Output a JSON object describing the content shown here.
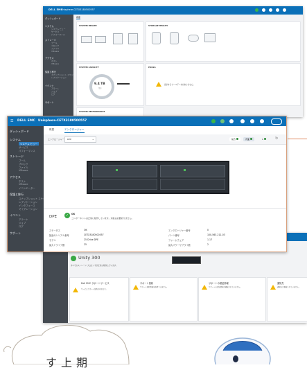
{
  "top_window": {
    "brand": "DELL EMC",
    "title": "Unisphere-CETX3180500557",
    "sidebar": [
      {
        "label": "ダッシュボード"
      },
      {
        "label": "システム",
        "sub": [
          "システム ビュー",
          "サービス",
          "パフォーマンス"
        ]
      },
      {
        "label": "ストレージ",
        "sub": [
          "プール",
          "ブロック",
          "ファイル",
          "VMware"
        ]
      },
      {
        "label": "アクセス",
        "sub": [
          "ホスト",
          "VMware"
        ]
      },
      {
        "label": "保護と移行",
        "sub": [
          "スナップショット スケジュール",
          "レプリケーション"
        ]
      },
      {
        "label": "イベント",
        "sub": [
          "アラート",
          "ジョブ",
          "ログ"
        ]
      },
      {
        "label": "サポート"
      }
    ],
    "tab": "概要",
    "cards": {
      "system_health": "SYSTEM HEALTH",
      "storage_health": "STORAGE HEALTH",
      "system_capacity": "SYSTEM CAPACITY",
      "pools": "POOLS",
      "system_performance": "SYSTEM PERFORMANCE",
      "capacity_value": "9.4 TB",
      "capacity_unit": "空き",
      "pools_message": "表示するプールデータがありません。"
    }
  },
  "main_window": {
    "brand": "DELL EMC",
    "title": "Unisphere-CETX3180500557",
    "sidebar": [
      {
        "label": "ダッシュボード"
      },
      {
        "label": "システム",
        "sub": [
          "システム ビュー",
          "サービス",
          "パフォーマンス"
        ]
      },
      {
        "label": "ストレージ",
        "sub": [
          "プール",
          "ブロック",
          "ファイル",
          "VMware"
        ]
      },
      {
        "label": "アクセス",
        "sub": [
          "ホスト",
          "VMware",
          "イニシエーター"
        ]
      },
      {
        "label": "保護と移行",
        "sub": [
          "スナップショット スケジュール",
          "レプリケーション",
          "インタフェース",
          "マイグレーション"
        ]
      },
      {
        "label": "イベント",
        "sub": [
          "アラート",
          "ジョブ",
          "ログ"
        ]
      },
      {
        "label": "サポート"
      }
    ],
    "tabs": [
      "概要",
      "エンクロージャー"
    ],
    "enclosure_label": "エンクロージャー",
    "enclosure_value": "DPE",
    "legend": [
      {
        "label": "前方",
        "color": "#2e8b3a"
      },
      {
        "label": "背面",
        "color": "#2e8b3a"
      },
      {
        "label": "0",
        "color": "#2e8b3a"
      }
    ],
    "dpe_name": "DPE",
    "dpe_status": "OK",
    "dpe_message": "コンポーネントは正常に動作しています。対処は必要ありません。",
    "props_left": [
      {
        "k": "ステータス",
        "v": "OK"
      },
      {
        "k": "製品のシリアル番号",
        "v": "CETX3180500557"
      },
      {
        "k": "モデル",
        "v": "25 Drive DPE"
      },
      {
        "k": "最大ドライブ数",
        "v": "25"
      }
    ],
    "props_right": [
      {
        "k": "エンクロージャー番号",
        "v": "0"
      },
      {
        "k": "パーツ番号",
        "v": "100-563-211-03"
      },
      {
        "k": "ファームウェア",
        "v": "1.17"
      },
      {
        "k": "最大パワーサプライ数",
        "v": "2"
      }
    ]
  },
  "bottom_window": {
    "product": "Unity 300",
    "product_message": "すべてのストレージ プロセッサが正常に動作しています。",
    "cards": [
      {
        "title": "Dell EMC サポートサービス",
        "text": "サービスサポート契約が有効です。"
      },
      {
        "title": "サポート契約",
        "text": "サポート契約情報を取得できません。"
      },
      {
        "title": "サポートの認証情報",
        "text": "サポートの認証情報が構成されていません。"
      },
      {
        "title": "通知先",
        "text": "通知先が構成されていません。"
      }
    ]
  },
  "bubble": {
    "line1": "期",
    "line2": "上",
    "line3": "す"
  }
}
